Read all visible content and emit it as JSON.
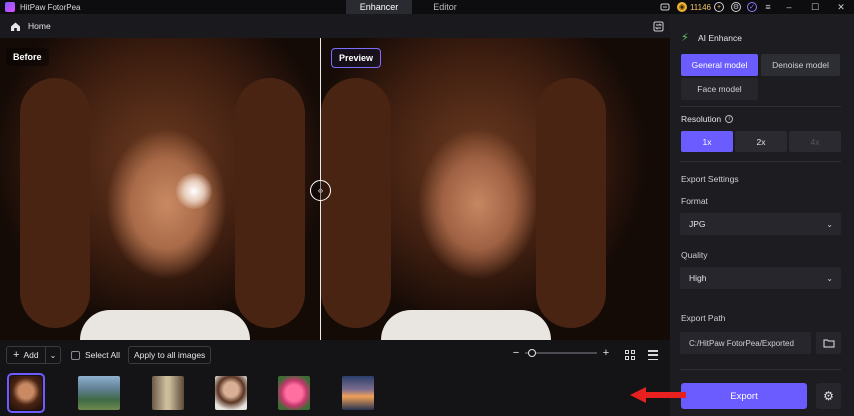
{
  "titlebar": {
    "app_title": "HitPaw FotorPea",
    "tabs": [
      {
        "label": "Enhancer",
        "active": true
      },
      {
        "label": "Editor",
        "active": false
      }
    ],
    "coins": "11146"
  },
  "homebar": {
    "home_label": "Home"
  },
  "viewer": {
    "before_label": "Before",
    "preview_label": "Preview",
    "divider_handle": "‹›"
  },
  "toolbar": {
    "add_label": "Add",
    "select_all_label": "Select All",
    "apply_label": "Apply to all images",
    "zoom_level": 0.05
  },
  "thumbnails": [
    {
      "name": "portrait",
      "selected": true
    },
    {
      "name": "landscape",
      "selected": false
    },
    {
      "name": "street",
      "selected": false
    },
    {
      "name": "woman",
      "selected": false
    },
    {
      "name": "flower",
      "selected": false
    },
    {
      "name": "sunset",
      "selected": false
    }
  ],
  "panel": {
    "title": "AI Enhance",
    "models": [
      "General model",
      "Denoise model",
      "Face model"
    ],
    "active_model": "General model",
    "resolution_label": "Resolution",
    "resolutions": [
      "1x",
      "2x",
      "4x"
    ],
    "export_settings_label": "Export Settings",
    "format_label": "Format",
    "format_value": "JPG",
    "quality_label": "Quality",
    "quality_value": "High",
    "export_path_label": "Export Path",
    "export_path_value": "C:/HitPaw FotorPea/Exported",
    "export_button": "Export"
  },
  "colors": {
    "accent": "#6b5cff",
    "annotation_arrow": "#e8201f"
  }
}
